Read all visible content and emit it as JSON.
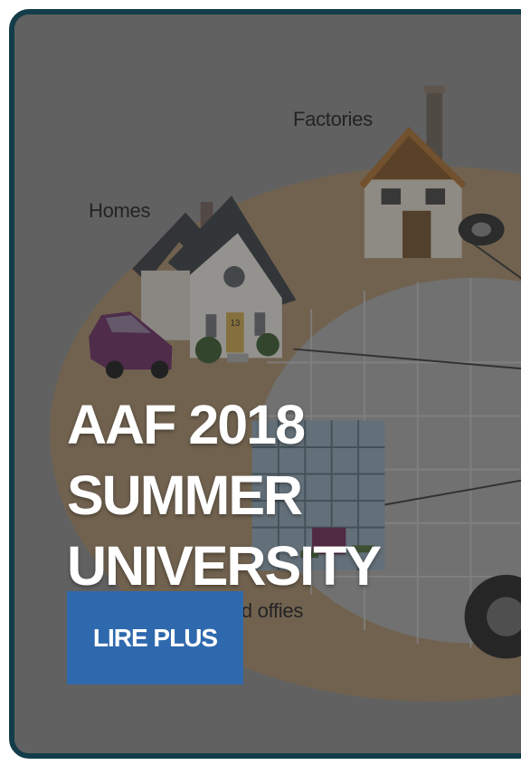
{
  "hero": {
    "title_line1": "AAF 2018 SUMMER",
    "title_line2": "UNIVERSITY",
    "button_label": "LIRE PLUS"
  },
  "illustration": {
    "labels": {
      "factories": "Factories",
      "homes": "Homes",
      "cities": "Cities and offies"
    },
    "house_number": "13"
  },
  "colors": {
    "card_border": "#143c4a",
    "button_background": "#2f69ad",
    "title_text": "#ffffff"
  }
}
